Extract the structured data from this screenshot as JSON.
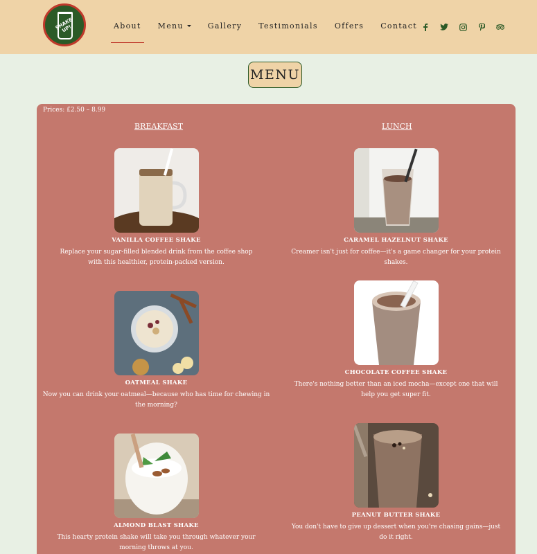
{
  "brand": {
    "logo_text": "SHAKE UP!"
  },
  "nav": {
    "items": [
      "About",
      "Menu",
      "Gallery",
      "Testimonials",
      "Offers",
      "Contact"
    ]
  },
  "social": [
    "facebook-icon",
    "twitter-icon",
    "instagram-icon",
    "pinterest-icon",
    "tripadvisor-icon"
  ],
  "colors": {
    "nav_bg": "#efd3a7",
    "panel_bg": "#c4786d",
    "accent_green": "#2b5a27",
    "accent_red": "#c0392b"
  },
  "page": {
    "title": "MENU",
    "prices": "Prices: £2.50 – 8.99",
    "columns": [
      {
        "heading": "BREAKFAST",
        "items": [
          {
            "name": "VANILLA COFFEE SHAKE",
            "desc": "Replace your sugar-filled blended drink from the coffee shop with this healthier, protein-packed version."
          },
          {
            "name": "OATMEAL SHAKE",
            "desc": "Now you can drink your oatmeal—because who has time for chewing in the morning?"
          },
          {
            "name": "ALMOND BLAST SHAKE",
            "desc": "This hearty protein shake will take you through whatever your morning throws at you."
          }
        ]
      },
      {
        "heading": "LUNCH",
        "items": [
          {
            "name": "CARAMEL HAZELNUT SHAKE",
            "desc": "Creamer isn't just for coffee—it's a game changer for your protein shakes."
          },
          {
            "name": "CHOCOLATE COFFEE SHAKE",
            "desc": "There's nothing better than an iced mocha—except one that will help you get super fit."
          },
          {
            "name": "PEANUT BUTTER SHAKE",
            "desc": "You don't have to give up dessert when you're chasing gains—just do it right."
          }
        ]
      }
    ]
  }
}
